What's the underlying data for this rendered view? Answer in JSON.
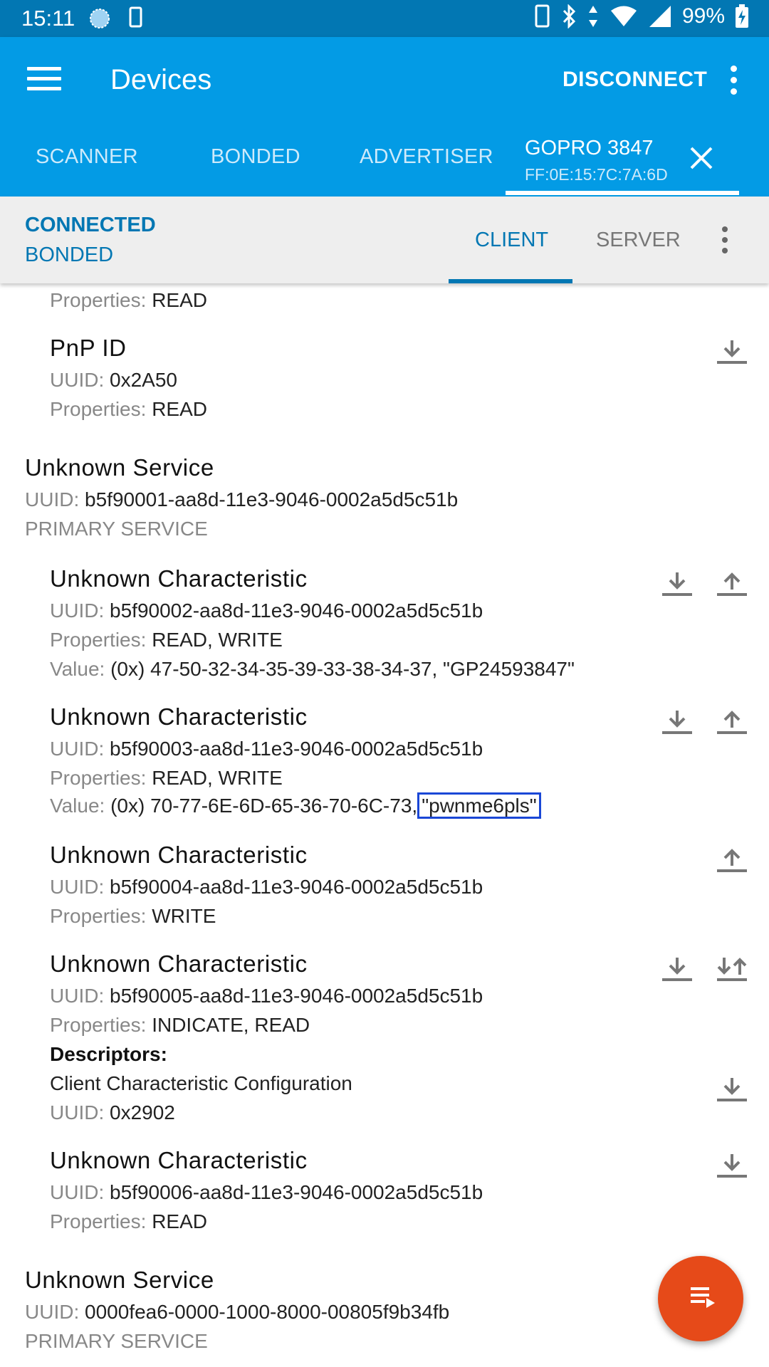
{
  "status_bar": {
    "time": "15:11",
    "battery": "99%"
  },
  "app_bar": {
    "title": "Devices",
    "disconnect_label": "DISCONNECT"
  },
  "tabs": {
    "scanner": "SCANNER",
    "bonded": "BONDED",
    "advertiser": "ADVERTISER",
    "device_name": "GOPRO 3847",
    "device_address": "FF:0E:15:7C:7A:6D"
  },
  "connection": {
    "state": "CONNECTED",
    "bond_state": "BONDED",
    "client_tab": "CLIENT",
    "server_tab": "SERVER"
  },
  "labels": {
    "uuid": "UUID:",
    "properties": "Properties:",
    "value": "Value:",
    "descriptors": "Descriptors:",
    "primary_service": "PRIMARY SERVICE"
  },
  "items": {
    "partial_properties": "READ",
    "pnp": {
      "name": "PnP ID",
      "uuid": "0x2A50",
      "properties": "READ"
    },
    "service1": {
      "name": "Unknown Service",
      "uuid": "b5f90001-aa8d-11e3-9046-0002a5d5c51b"
    },
    "char2": {
      "name": "Unknown Characteristic",
      "uuid": "b5f90002-aa8d-11e3-9046-0002a5d5c51b",
      "properties": "READ, WRITE",
      "value_hex": "(0x) 47-50-32-34-35-39-33-38-34-37, \"GP24593847\""
    },
    "char3": {
      "name": "Unknown Characteristic",
      "uuid": "b5f90003-aa8d-11e3-9046-0002a5d5c51b",
      "properties": "READ, WRITE",
      "value_hex": "(0x) 70-77-6E-6D-65-36-70-6C-73,",
      "value_text": "\"pwnme6pls\""
    },
    "char4": {
      "name": "Unknown Characteristic",
      "uuid": "b5f90004-aa8d-11e3-9046-0002a5d5c51b",
      "properties": "WRITE"
    },
    "char5": {
      "name": "Unknown Characteristic",
      "uuid": "b5f90005-aa8d-11e3-9046-0002a5d5c51b",
      "properties": "INDICATE, READ",
      "descriptor_name": "Client Characteristic Configuration",
      "descriptor_uuid": "0x2902"
    },
    "char6": {
      "name": "Unknown Characteristic",
      "uuid": "b5f90006-aa8d-11e3-9046-0002a5d5c51b",
      "properties": "READ"
    },
    "service2": {
      "name": "Unknown Service",
      "uuid": "0000fea6-0000-1000-8000-00805f9b34fb"
    }
  },
  "colors": {
    "app_bar": "#039be5",
    "status_bar": "#0277b3",
    "accent": "#0277b3",
    "fab": "#e64a19",
    "highlight_box": "#1a47d6"
  }
}
